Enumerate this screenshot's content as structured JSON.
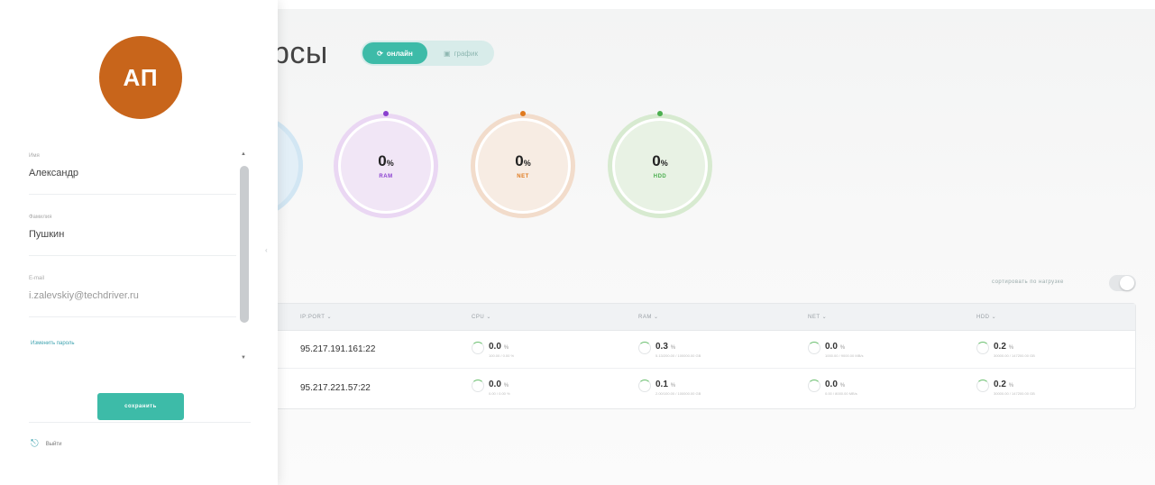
{
  "header": {
    "title": "рсы"
  },
  "view_toggle": {
    "active_label": "онлайн",
    "inactive_label": "график"
  },
  "gauges": [
    {
      "value": "0",
      "unit": "%",
      "label": "RAM",
      "color": "#8a3fcf",
      "bg": "#f1e6f6",
      "ring": "#ead7f3"
    },
    {
      "value": "0",
      "unit": "%",
      "label": "NET",
      "color": "#e07a1f",
      "bg": "#f7ece3",
      "ring": "#f2dccb"
    },
    {
      "value": "0",
      "unit": "%",
      "label": "HDD",
      "color": "#4caf50",
      "bg": "#e8f2e4",
      "ring": "#d7ead0"
    }
  ],
  "sort": {
    "label": "сортировать по нагрузке"
  },
  "table": {
    "headers": [
      "IP:PORT",
      "CPU",
      "RAM",
      "NET",
      "HDD"
    ],
    "rows": [
      {
        "ip": "95.217.191.161:22",
        "cpu": {
          "value": "0.0",
          "unit": "%",
          "detail": "100.00 / 0.00 %"
        },
        "ram": {
          "value": "0.3",
          "unit": "%",
          "detail": "5.13/200.00 / 100000.00 GB"
        },
        "net": {
          "value": "0.0",
          "unit": "%",
          "detail": "1000.00 / 9000.00 MB/s"
        },
        "hdd": {
          "value": "0.2",
          "unit": "%",
          "detail": "30000.00 / 147200.00 GB"
        }
      },
      {
        "ip": "95.217.221.57:22",
        "cpu": {
          "value": "0.0",
          "unit": "%",
          "detail": "0.00 / 0.00 %"
        },
        "ram": {
          "value": "0.1",
          "unit": "%",
          "detail": "2.00/100.00 / 100000.00 GB"
        },
        "net": {
          "value": "0.0",
          "unit": "%",
          "detail": "0.00 / 8000.00 MB/s"
        },
        "hdd": {
          "value": "0.2",
          "unit": "%",
          "detail": "30000.00 / 147200.00 GB"
        }
      }
    ]
  },
  "profile": {
    "initials": "АП",
    "first_name_label": "Имя",
    "first_name": "Александр",
    "last_name_label": "Фамилия",
    "last_name": "Пушкин",
    "email_label": "E-mail",
    "email": "i.zalevskiy@techdriver.ru",
    "change_password": "Изменить пароль",
    "save": "сохранить",
    "logout": "Выйти"
  }
}
